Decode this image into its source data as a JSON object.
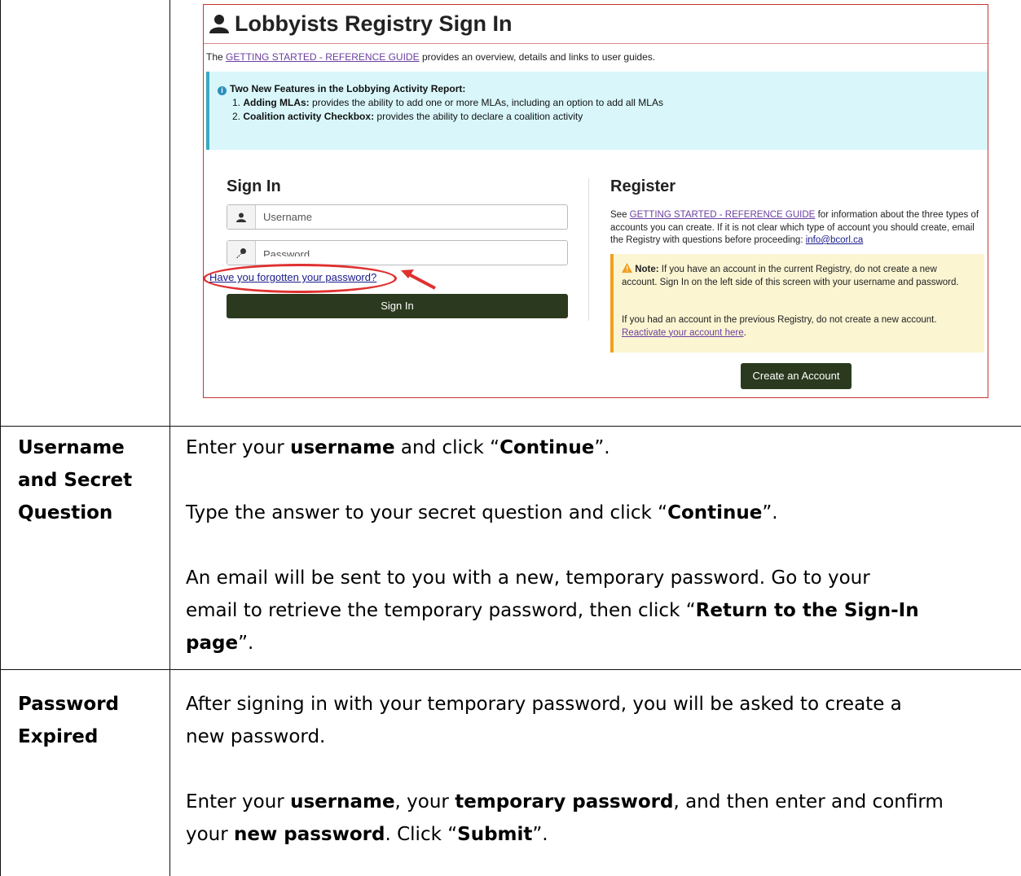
{
  "screenshot": {
    "title": "Lobbyists Registry Sign In",
    "guide_link": "GETTING STARTED - REFERENCE GUIDE",
    "guide_suffix": "provides an overview, details and links to user guides.",
    "guide_prefix": "The",
    "alert": {
      "heading": "Two New Features in the Lobbying Activity Report:",
      "item1_num": "1.",
      "item1_bold": "Adding MLAs:",
      "item1_text": "provides the ability to add one or more MLAs, including an option to add all MLAs",
      "item2_num": "2.",
      "item2_bold": "Coalition activity Checkbox:",
      "item2_text": "provides the ability to declare a coalition activity"
    },
    "signin": {
      "heading": "Sign In",
      "username_placeholder": "Username",
      "password_placeholder": "Password",
      "forgot_link": "Have you forgotten your password?",
      "button": "Sign In"
    },
    "register": {
      "heading": "Register",
      "text_prefix": "See",
      "guide_link": "GETTING STARTED - REFERENCE GUIDE",
      "text_mid": "for information about the three types of accounts you can create. If it is not clear which type of account you should create, email the Registry with questions before proceeding:",
      "email_link": "info@bcorl.ca",
      "note_bold": "Note:",
      "note_text": "If you have an account in the current Registry, do not create a new account. Sign In on the left side of this screen with your username and password.",
      "note_text2": "If you had an account in the previous Registry, do not create a new account.",
      "reactivate_link": "Reactivate your account here",
      "button": "Create an Account"
    },
    "annotation_color": "#e03030"
  },
  "rows": [
    {
      "label_lines": [
        "Username",
        "and Secret",
        "Question"
      ],
      "p1_a": "Enter your ",
      "p1_b": "username",
      "p1_c": " and click “",
      "p1_d": "Continue",
      "p1_e": "”.",
      "p2_a": "Type the answer to your secret question and click “",
      "p2_b": "Continue",
      "p2_c": "”.",
      "p3_line1": "An email will be sent to you with a new, temporary password. Go to your",
      "p3_line2_a": "email to retrieve the temporary password, then click “",
      "p3_line2_b": "Return to the Sign-In",
      "p3_line3_a": "page",
      "p3_line3_b": "”."
    },
    {
      "label_lines": [
        "Password",
        "Expired"
      ],
      "p1_line1": "After signing in with your temporary password, you will be asked to create a",
      "p1_line2": "new password.",
      "p2_a": "Enter your ",
      "p2_b": "username",
      "p2_c": ", your ",
      "p2_d": "temporary password",
      "p2_e": ", and then enter and confirm",
      "p2_f": "your ",
      "p2_g": "new password",
      "p2_h": ". Click “",
      "p2_i": "Submit",
      "p2_j": "”."
    }
  ]
}
